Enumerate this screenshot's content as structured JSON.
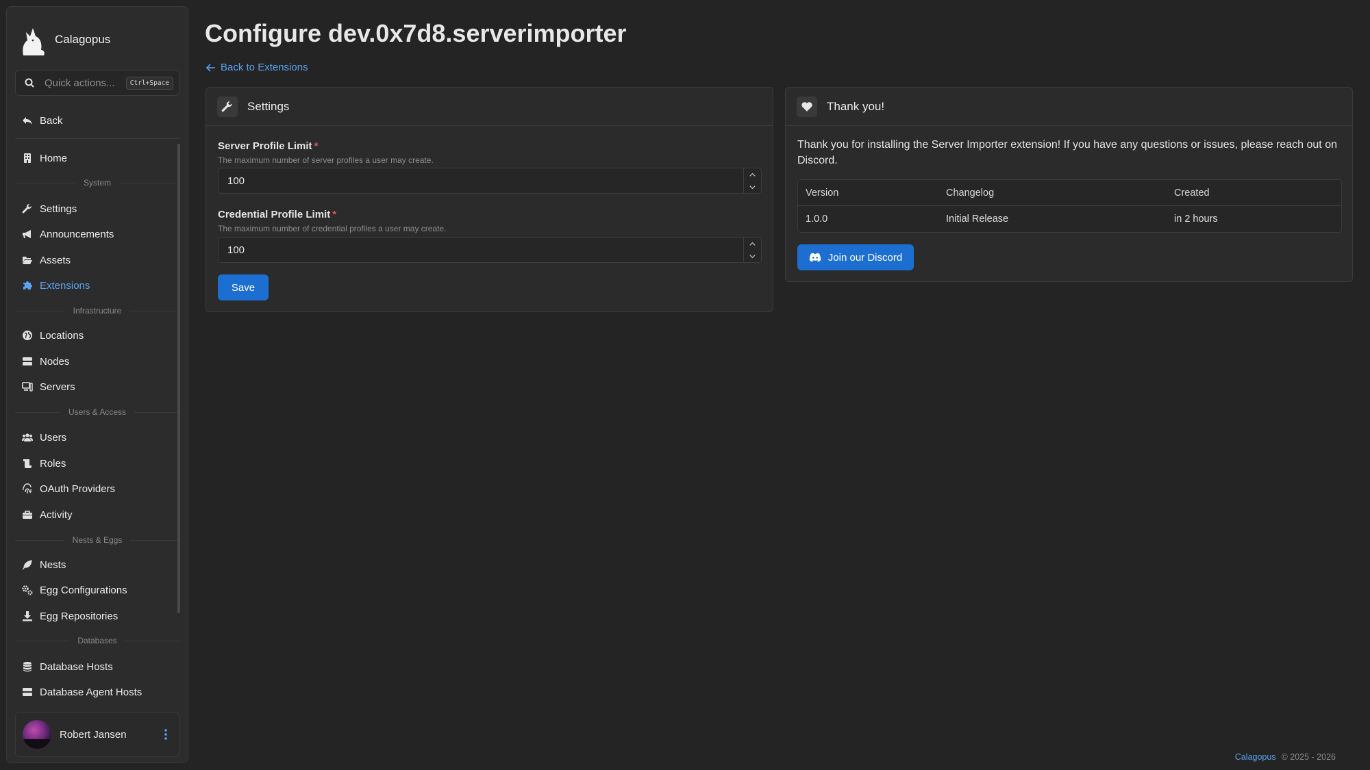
{
  "sidebar": {
    "brand": "Calagopus",
    "quick_actions": {
      "placeholder": "Quick actions...",
      "shortcut": "Ctrl+Space"
    },
    "back": "Back",
    "home": "Home",
    "sections": {
      "system": "System",
      "infrastructure": "Infrastructure",
      "users_access": "Users & Access",
      "nests_eggs": "Nests & Eggs",
      "databases": "Databases"
    },
    "items": {
      "settings": "Settings",
      "announcements": "Announcements",
      "assets": "Assets",
      "extensions": "Extensions",
      "locations": "Locations",
      "nodes": "Nodes",
      "servers": "Servers",
      "users": "Users",
      "roles": "Roles",
      "oauth_providers": "OAuth Providers",
      "activity": "Activity",
      "nests": "Nests",
      "egg_configurations": "Egg Configurations",
      "egg_repositories": "Egg Repositories",
      "database_hosts": "Database Hosts",
      "database_agent_hosts": "Database Agent Hosts"
    },
    "active_item": "Extensions",
    "user": {
      "name": "Robert Jansen"
    }
  },
  "page": {
    "title": "Configure dev.0x7d8.serverimporter",
    "back_link": "Back to Extensions"
  },
  "settings_card": {
    "title": "Settings",
    "server_profile_limit": {
      "label": "Server Profile Limit",
      "required": "*",
      "description": "The maximum number of server profiles a user may create.",
      "value": "100"
    },
    "credential_profile_limit": {
      "label": "Credential Profile Limit",
      "required": "*",
      "description": "The maximum number of credential profiles a user may create.",
      "value": "100"
    },
    "save_label": "Save"
  },
  "thanks_card": {
    "title": "Thank you!",
    "message": "Thank you for installing the Server Importer extension! If you have any questions or issues, please reach out on Discord.",
    "table": {
      "headers": {
        "version": "Version",
        "changelog": "Changelog",
        "created": "Created"
      },
      "rows": [
        {
          "version": "1.0.0",
          "changelog": "Initial Release",
          "created": "in 2 hours"
        }
      ]
    },
    "discord_button": "Join our Discord"
  },
  "footer": {
    "brand": "Calagopus",
    "copyright": "© 2025 - 2026"
  },
  "colors": {
    "accent": "#5aa2f0",
    "primary_button": "#1c6fd1",
    "background": "#242424",
    "panel": "#2b2b2b"
  }
}
